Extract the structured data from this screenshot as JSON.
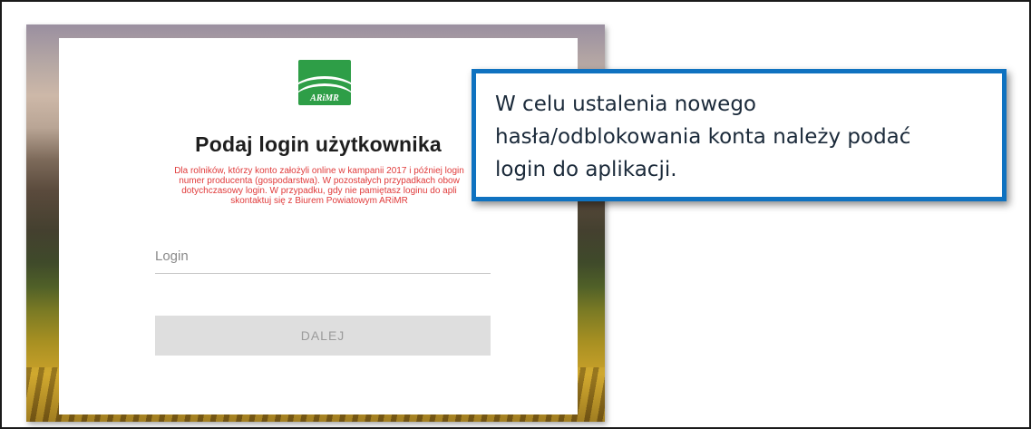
{
  "logo": {
    "text": "ARiMR"
  },
  "form": {
    "title": "Podaj login użytkownika",
    "notice_lines": [
      "Dla rolników, którzy konto założyli online w kampanii 2017 i później login",
      "numer producenta (gospodarstwa). W pozostałych przypadkach obow",
      "dotychczasowy login. W przypadku, gdy nie pamiętasz loginu do apli",
      "skontaktuj się z Biurem Powiatowym ARiMR"
    ],
    "login_placeholder": "Login",
    "next_button_label": "DALEJ"
  },
  "callout": {
    "lines": [
      "W celu ustalenia nowego",
      "hasła/odblokowania konta należy podać",
      "login do aplikacji."
    ]
  },
  "colors": {
    "brand_green": "#2e9e47",
    "notice_red": "#e03a3a",
    "callout_border": "#0f72c0",
    "button_bg": "#dedede"
  }
}
